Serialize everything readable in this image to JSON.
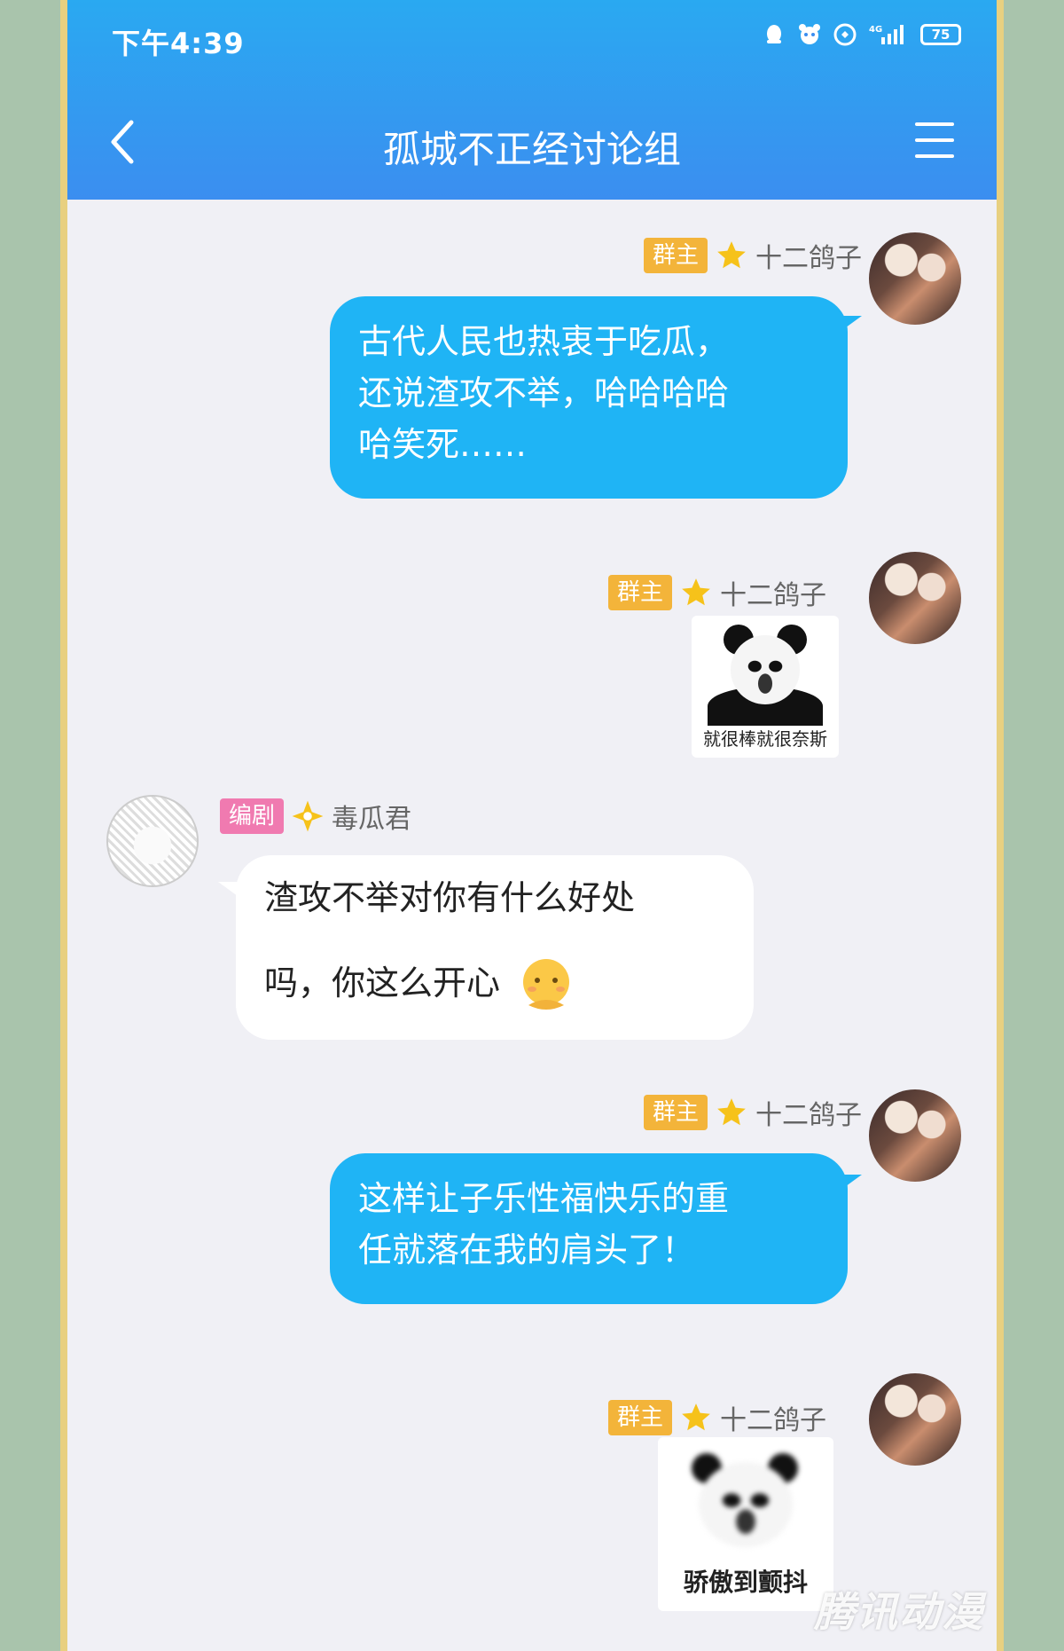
{
  "status_bar": {
    "time": "下午4:39",
    "network": "4G",
    "battery": "75"
  },
  "header": {
    "title": "孤城不正经讨论组"
  },
  "messages": [
    {
      "badge": "群主",
      "sender": "十二鸽子",
      "text_lines": [
        "古代人民也热衷于吃瓜，",
        "还说渣攻不举，哈哈哈哈",
        "哈笑死……"
      ]
    },
    {
      "badge": "群主",
      "sender": "十二鸽子",
      "sticker_caption": "就很棒就很奈斯"
    },
    {
      "badge": "编剧",
      "sender": "毒瓜君",
      "text_lines": [
        "渣攻不举对你有什么好处",
        "吗，你这么开心"
      ]
    },
    {
      "badge": "群主",
      "sender": "十二鸽子",
      "text_lines": [
        "这样让子乐性福快乐的重",
        "任就落在我的肩头了！"
      ]
    },
    {
      "badge": "群主",
      "sender": "十二鸽子",
      "sticker_caption": "骄傲到颤抖"
    }
  ],
  "watermark": "腾讯动漫",
  "colors": {
    "header": "#2aa9f1",
    "my_bubble": "#1fb4f5",
    "owner_badge": "#f3b43a",
    "writer_badge": "#f07ab0"
  },
  "icons": [
    "back-icon",
    "menu-icon",
    "star-icon",
    "diamond-star-icon",
    "shy-emoji-icon"
  ]
}
